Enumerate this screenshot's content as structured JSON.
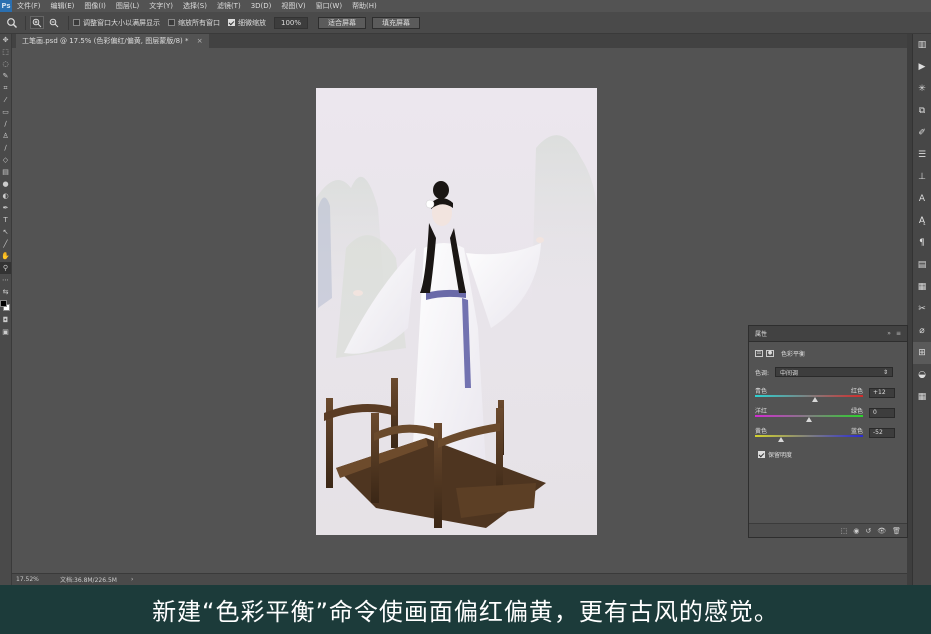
{
  "app": {
    "logo": "Ps"
  },
  "menu": {
    "items": [
      "文件(F)",
      "编辑(E)",
      "图像(I)",
      "图层(L)",
      "文字(Y)",
      "选择(S)",
      "滤镜(T)",
      "3D(D)",
      "视图(V)",
      "窗口(W)",
      "帮助(H)"
    ]
  },
  "options": {
    "tool_icon": "zoom-icon",
    "resize_windows_label": "调整窗口大小以满屏显示",
    "resize_windows_checked": false,
    "zoom_all_label": "缩放所有窗口",
    "zoom_all_checked": false,
    "scrubby_zoom_label": "细微缩放",
    "scrubby_zoom_checked": true,
    "zoom_value": "100%",
    "fit_screen_label": "适合屏幕",
    "fill_screen_label": "填充屏幕"
  },
  "document": {
    "tab_title": "工笔画.psd @ 17.5% (色彩偏红/偏黄, 图层蒙版/8) *",
    "close_glyph": "×"
  },
  "status": {
    "zoom": "17.52%",
    "doc_info": "文档:36.8M/226.5M",
    "arrow": "›"
  },
  "properties": {
    "panel_title": "属性",
    "panel_collapse": "»",
    "panel_menu": "≡",
    "adjustment_name": "色彩平衡",
    "tone_label": "色调:",
    "tone_value": "中间调",
    "sliders": [
      {
        "left_label": "青色",
        "right_label": "红色",
        "value": "+12",
        "amount": 12
      },
      {
        "left_label": "洋红",
        "right_label": "绿色",
        "value": "0",
        "amount": 0
      },
      {
        "left_label": "黄色",
        "right_label": "蓝色",
        "value": "-52",
        "amount": -52
      }
    ],
    "preserve_label": "保留明度",
    "preserve_checked": true
  },
  "caption": {
    "text": "新建“色彩平衡”命令使画面偏红偏黄，更有古风的感觉。"
  },
  "colors": {
    "caption_bg": "#1c3b3a",
    "ui_bg": "#535353"
  }
}
